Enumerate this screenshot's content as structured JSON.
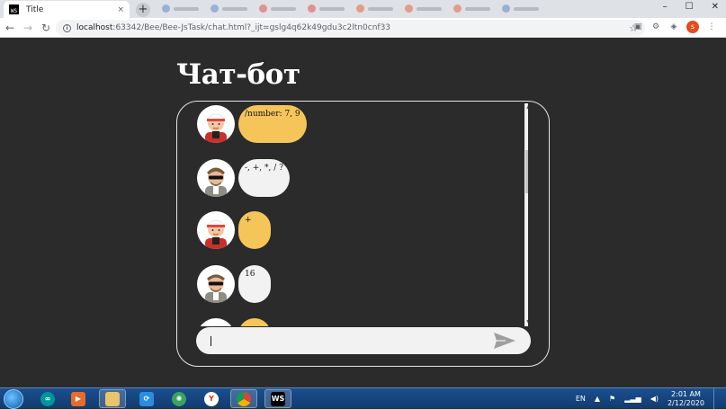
{
  "browser": {
    "tab_title": "Title",
    "tab_close": "×",
    "new_tab": "+",
    "url_host": "localhost",
    "url_path": ":63342/Bee/Bee-JsTask/chat.html?_ijt=gslg4q62k49gdu3c2ltn0cnf33",
    "window_controls": [
      "–",
      "☐",
      "✕"
    ],
    "profile_initial": "s"
  },
  "page": {
    "heading": "Чат-бот"
  },
  "chat": {
    "messages": [
      {
        "sender": "user",
        "text": "/number: 7, 9"
      },
      {
        "sender": "bot",
        "text": "-, +, *, / ?"
      },
      {
        "sender": "user",
        "text": "+"
      },
      {
        "sender": "bot",
        "text": "16"
      },
      {
        "sender": "user",
        "text": ""
      }
    ],
    "input_value": "",
    "send_icon": "send-icon"
  },
  "taskbar": {
    "language": "EN",
    "time": "2:01 AM",
    "date": "2/12/2020"
  },
  "colors": {
    "page_bg": "#2b2b2b",
    "user_bubble": "#f6c55a",
    "bot_bubble": "#f2f2f2"
  }
}
